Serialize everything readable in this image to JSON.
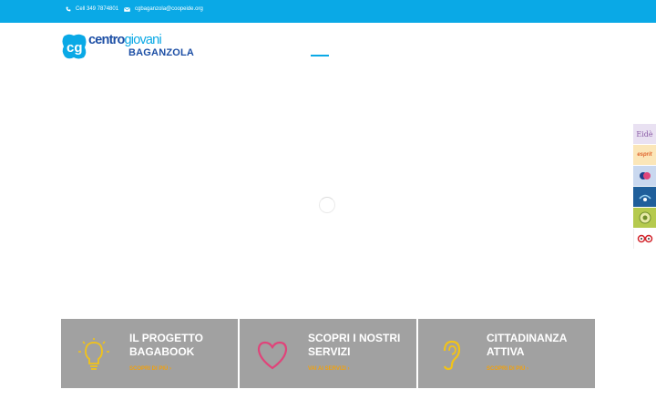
{
  "topbar": {
    "phone": "Cell 349 7874801",
    "email": "cgbaganzola@coopeide.org",
    "phone_icon": "phone-icon",
    "email_icon": "envelope-icon"
  },
  "logo": {
    "word_a": "centro",
    "word_b": "giovani",
    "subtitle": "BAGANZOLA",
    "mark": "cg"
  },
  "sidebar": {
    "items": [
      {
        "label": "Eidè"
      },
      {
        "label": "esprit"
      },
      {
        "label": ""
      },
      {
        "label": ""
      },
      {
        "label": ""
      },
      {
        "label": ""
      }
    ]
  },
  "cards": [
    {
      "title": "IL PROGETTO BAGABOOK",
      "cta": "SCOPRI DI PIÙ",
      "icon": "lightbulb-icon"
    },
    {
      "title": "SCOPRI I NOSTRI SERVIZI",
      "cta": "VAI AI SERVIZI",
      "icon": "heart-icon"
    },
    {
      "title": "CITTADINANZA ATTIVA",
      "cta": "SCOPRI DI PIÙ",
      "icon": "ear-icon"
    }
  ],
  "colors": {
    "topbar": "#0aa9e6",
    "logo_dark": "#1d4fa5",
    "card_bg": "#a1a1a1",
    "cta": "#f2a10c",
    "lightbulb": "#f2c318",
    "heart": "#e0447a",
    "ear": "#f2c318"
  }
}
